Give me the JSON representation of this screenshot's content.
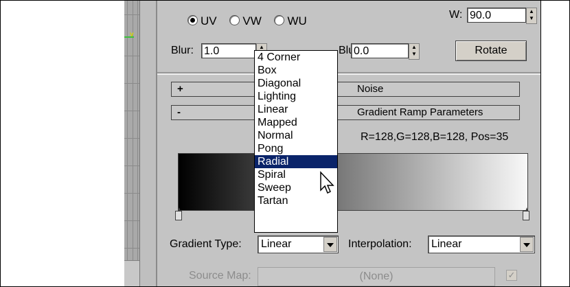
{
  "coords": {
    "radio_options": [
      {
        "label": "UV",
        "checked": true
      },
      {
        "label": "VW",
        "checked": false
      },
      {
        "label": "WU",
        "checked": false
      }
    ],
    "w_label": "W:",
    "w_value": "90.0",
    "blur_label": "Blur:",
    "blur_value": "1.0",
    "blur_offset_label": "Blur offset:",
    "blur_offset_value": "0.0",
    "rotate_button": "Rotate"
  },
  "rollouts": {
    "noise": {
      "sign": "+",
      "title": "Noise"
    },
    "ramp": {
      "sign": "-",
      "title": "Gradient Ramp Parameters"
    }
  },
  "ramp": {
    "color_readout": "R=128,G=128,B=128, Pos=35",
    "gradient_type_label": "Gradient Type:",
    "gradient_type_value": "Linear",
    "interpolation_label": "Interpolation:",
    "interpolation_value": "Linear",
    "source_map_label": "Source Map:",
    "source_map_value": "(None)",
    "checkbox_checked": true
  },
  "dropdown": {
    "items": [
      "4 Corner",
      "Box",
      "Diagonal",
      "Lighting",
      "Linear",
      "Mapped",
      "Normal",
      "Pong",
      "Radial",
      "Spiral",
      "Sweep",
      "Tartan"
    ],
    "highlighted": "Radial"
  },
  "colors": {
    "panel_bg": "#c4c4c4",
    "selection": "#0a246a"
  },
  "icons": [
    "spinner-icon",
    "dropdown-arrow-icon",
    "mouse-cursor-icon",
    "checkbox-icon",
    "gradient-flag-icon"
  ]
}
